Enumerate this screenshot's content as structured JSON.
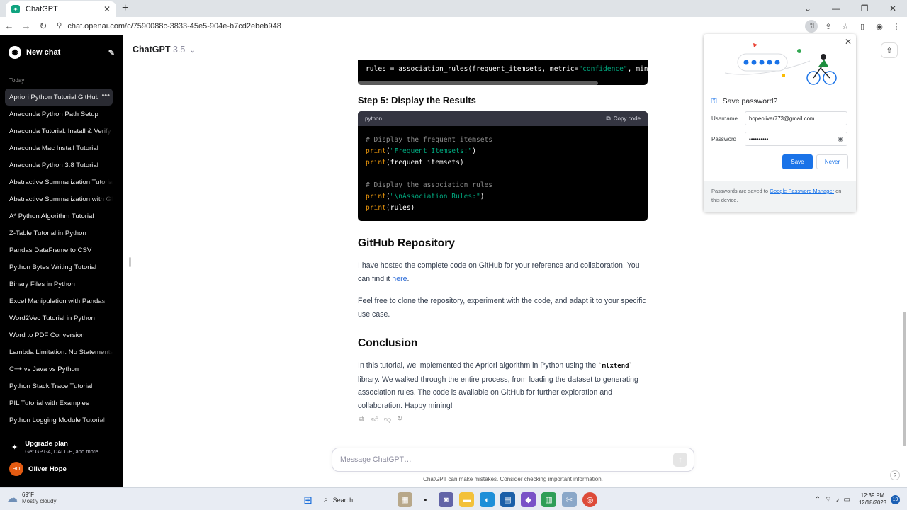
{
  "browser": {
    "tab_title": "ChatGPT",
    "url": "chat.openai.com/c/7590088c-3833-45e5-904e-b7cd2ebeb948"
  },
  "sidebar": {
    "new_chat": "New chat",
    "section_today": "Today",
    "items": [
      {
        "label": "Apriori Python Tutorial GitHub"
      },
      {
        "label": "Anaconda Python Path Setup"
      },
      {
        "label": "Anaconda Tutorial: Install & Verify"
      },
      {
        "label": "Anaconda Mac Install Tutorial"
      },
      {
        "label": "Anaconda Python 3.8 Tutorial"
      },
      {
        "label": "Abstractive Summarization Tutorial"
      },
      {
        "label": "Abstractive Summarization with GPT"
      },
      {
        "label": "A* Python Algorithm Tutorial"
      },
      {
        "label": "Z-Table Tutorial in Python"
      },
      {
        "label": "Pandas DataFrame to CSV"
      },
      {
        "label": "Python Bytes Writing Tutorial"
      },
      {
        "label": "Binary Files in Python"
      },
      {
        "label": "Excel Manipulation with Pandas"
      },
      {
        "label": "Word2Vec Tutorial in Python"
      },
      {
        "label": "Word to PDF Conversion"
      },
      {
        "label": "Lambda Limitation: No Statements"
      },
      {
        "label": "C++ vs Java vs Python"
      },
      {
        "label": "Python Stack Trace Tutorial"
      },
      {
        "label": "PIL Tutorial with Examples"
      },
      {
        "label": "Python Logging Module Tutorial"
      }
    ],
    "upgrade_title": "Upgrade plan",
    "upgrade_sub": "Get GPT-4, DALL·E, and more",
    "user_initials": "HO",
    "user_name": "Oliver Hope"
  },
  "header": {
    "model": "ChatGPT",
    "version": "3.5"
  },
  "content": {
    "code_top_line_var": "rules = association_rules(frequent_itemsets, metric=",
    "code_top_line_str": "\"confidence\"",
    "code_top_line_rest": ", min_t",
    "step5_heading": "Step 5: Display the Results",
    "code_lang": "python",
    "copy_code": "Copy code",
    "code_lines": [
      {
        "cmt": "# Display the frequent itemsets"
      },
      {
        "fn": "print",
        "arg_str": "\"Frequent Itemsets:\"",
        "tail": ")"
      },
      {
        "fn": "print",
        "arg_plain": "(frequent_itemsets)"
      },
      {
        "blank": ""
      },
      {
        "cmt": "# Display the association rules"
      },
      {
        "fn": "print",
        "arg_str": "\"\\nAssociation Rules:\"",
        "tail": ")"
      },
      {
        "fn": "print",
        "arg_plain": "(rules)"
      }
    ],
    "github_heading": "GitHub Repository",
    "github_p1_a": "I have hosted the complete code on GitHub for your reference and collaboration. You can find it ",
    "github_p1_link": "here",
    "github_p1_end": ".",
    "github_p2": "Feel free to clone the repository, experiment with the code, and adapt it to your specific use case.",
    "conclusion_heading": "Conclusion",
    "conclusion_a": "In this tutorial, we implemented the Apriori algorithm in Python using the ",
    "conclusion_code": "`mlxtend`",
    "conclusion_b": " library. We walked through the entire process, from loading the dataset to generating association rules. The code is available on GitHub for further exploration and collaboration. Happy mining!"
  },
  "composer": {
    "placeholder": "Message ChatGPT…",
    "disclaimer": "ChatGPT can make mistakes. Consider checking important information."
  },
  "password_popup": {
    "title": "Save password?",
    "username_label": "Username",
    "username_value": "hopeoliver773@gmail.com",
    "password_label": "Password",
    "password_value": "••••••••••",
    "save": "Save",
    "never": "Never",
    "footer_a": "Passwords are saved to ",
    "footer_link": "Google Password Manager",
    "footer_b": " on this device."
  },
  "taskbar": {
    "temp": "69°F",
    "weather": "Mostly cloudy",
    "search": "Search",
    "time": "12:39 PM",
    "date": "12/18/2023",
    "notifications": "19"
  },
  "colors": {
    "sidebar_bg": "#000000",
    "accent_blue": "#1a73e8",
    "code_string": "#00a67d",
    "code_keyword": "#e9950c"
  }
}
